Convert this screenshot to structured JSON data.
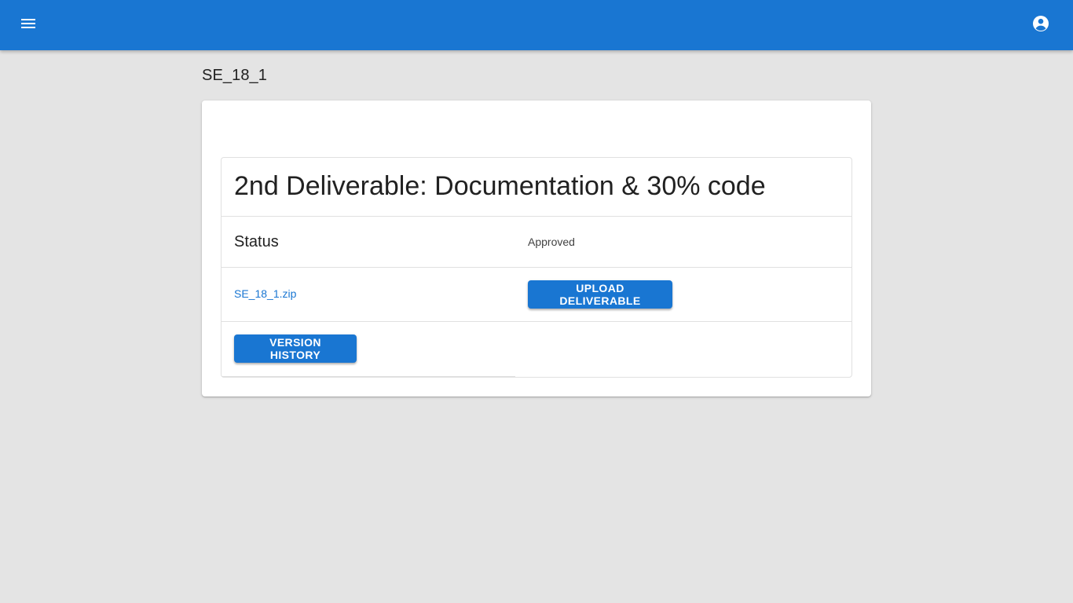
{
  "header": {
    "menu_icon": "menu-icon",
    "account_icon": "account-circle-icon",
    "background_color": "#1976d2"
  },
  "page": {
    "title": "SE_18_1"
  },
  "deliverable": {
    "title": "2nd Deliverable: Documentation & 30% code",
    "status_label": "Status",
    "status_value": "Approved",
    "file_name": "SE_18_1.zip",
    "upload_label": "UPLOAD DELIVERABLE",
    "history_label": "VERSION HISTORY"
  },
  "colors": {
    "accent": "#1976d2",
    "background": "#e4e4e4",
    "card": "#ffffff"
  }
}
